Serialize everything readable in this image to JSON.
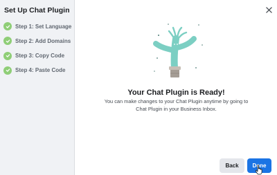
{
  "sidebar": {
    "title": "Set Up Chat Plugin",
    "steps": [
      {
        "label": "Step 1: Set Language",
        "status": "complete"
      },
      {
        "label": "Step 2: Add Domains",
        "status": "complete"
      },
      {
        "label": "Step 3: Copy Code",
        "status": "complete"
      },
      {
        "label": "Step 4: Paste Code",
        "status": "complete"
      }
    ]
  },
  "main": {
    "close_icon": "close-icon",
    "illustration": "inflatable-tube-man-illustration",
    "title": "Your Chat Plugin is Ready!",
    "description": "You can make changes to your Chat Plugin anytime by going to Chat Plugin in your Business Inbox."
  },
  "footer": {
    "back_label": "Back",
    "done_label": "Done"
  },
  "colors": {
    "sidebar_bg": "#f0f2f5",
    "step_check": "#8fce77",
    "primary": "#1b74e4",
    "secondary_bg": "#e4e6eb",
    "illustration_teal": "#7ccfc3"
  }
}
